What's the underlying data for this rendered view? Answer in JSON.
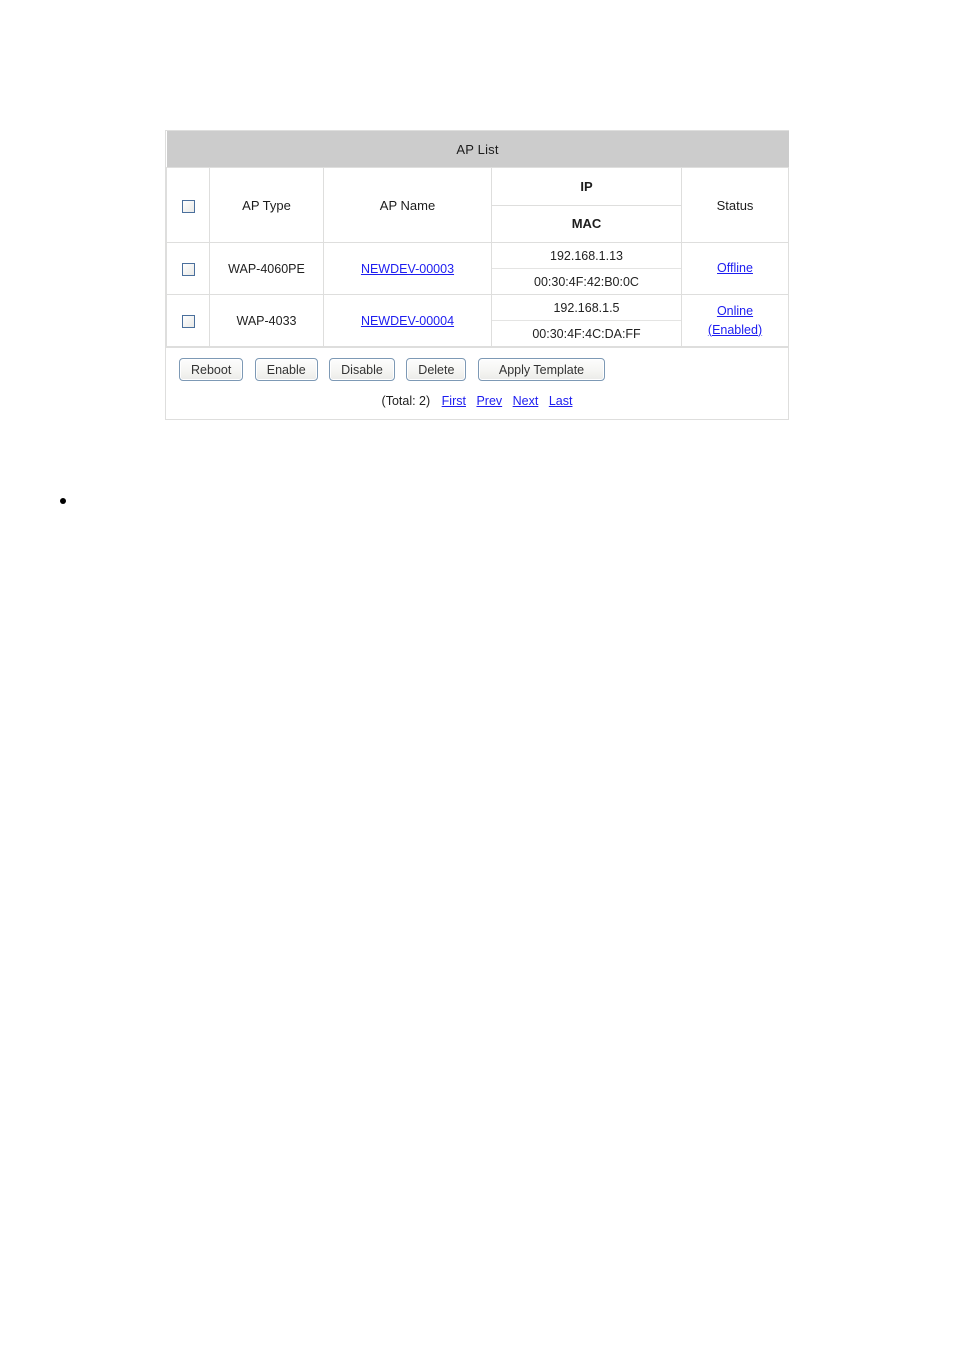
{
  "panel": {
    "title": "AP List"
  },
  "table": {
    "columns": {
      "select_all": "",
      "ap_type": "AP Type",
      "ap_name": "AP Name",
      "ip": "IP",
      "mac": "MAC",
      "status": "Status"
    },
    "rows": [
      {
        "checked": false,
        "ap_type": "WAP-4060PE",
        "ap_name": "NEWDEV-00003",
        "ip": "192.168.1.13",
        "mac": "00:30:4F:42:B0:0C",
        "status_line1": "Offline",
        "status_line2": ""
      },
      {
        "checked": false,
        "ap_type": "WAP-4033",
        "ap_name": "NEWDEV-00004",
        "ip": "192.168.1.5",
        "mac": "00:30:4F:4C:DA:FF",
        "status_line1": "Online",
        "status_line2": "(Enabled)"
      }
    ]
  },
  "buttons": {
    "reboot": "Reboot",
    "enable": "Enable",
    "disable": "Disable",
    "delete": "Delete",
    "apply_template": "Apply Template"
  },
  "pagination": {
    "total": "(Total: 2)",
    "first": "First",
    "prev": "Prev",
    "next": "Next",
    "last": "Last"
  },
  "bullet": {
    "text": ""
  },
  "colors": {
    "header_bg": "#cccccc",
    "link": "#1d1df0",
    "border": "#dededd",
    "checkbox_border": "#4a6f9c",
    "button_border": "#7d99b5"
  }
}
